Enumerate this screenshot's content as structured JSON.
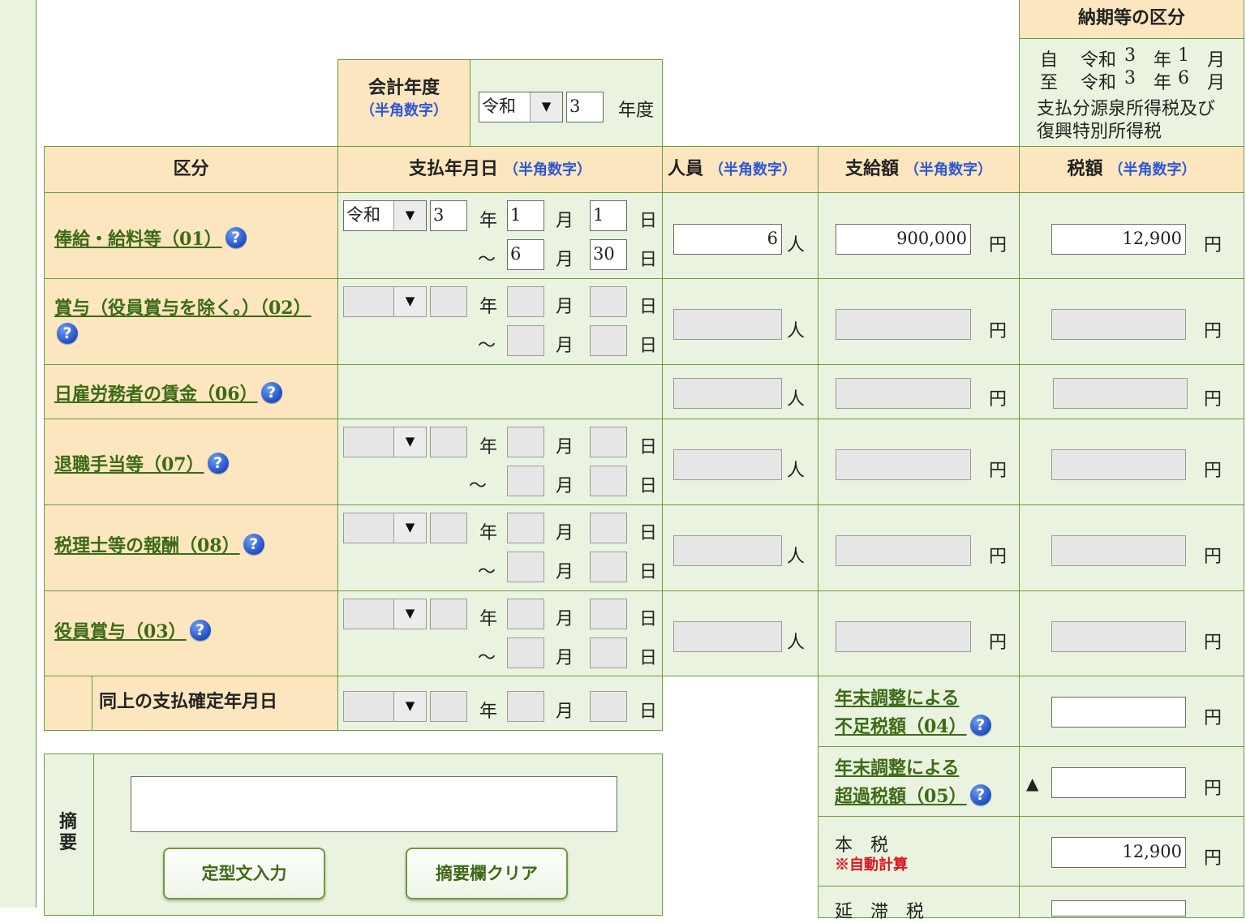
{
  "period": {
    "header": "納期等の区分",
    "from": {
      "prefix": "自",
      "era": "令和",
      "year": "3",
      "year_unit": "年",
      "month": "1",
      "month_unit": "月"
    },
    "to": {
      "prefix": "至",
      "era": "令和",
      "year": "3",
      "year_unit": "年",
      "month": "6",
      "month_unit": "月"
    },
    "desc_line1": "支払分源泉所得税及び",
    "desc_line2": "復興特別所得税"
  },
  "fiscal": {
    "label": "会計年度",
    "hint": "（半角数字）",
    "era": "令和",
    "year": "3",
    "unit": "年度"
  },
  "headers": {
    "kubun": "区分",
    "date": "支払年月日",
    "date_hint": "（半角数字）",
    "people": "人員",
    "people_hint": "（半角数字）",
    "amount": "支給額",
    "amount_hint": "（半角数字）",
    "tax": "税額",
    "tax_hint": "（半角数字）"
  },
  "units": {
    "year": "年",
    "month": "月",
    "day": "日",
    "tilde": "～",
    "person": "人",
    "yen": "円"
  },
  "rows": {
    "salary": {
      "label": "俸給・給料等（01）",
      "era": "令和",
      "year": "3",
      "month": "1",
      "day": "1",
      "end_month": "6",
      "end_day": "30",
      "people": "6",
      "amount": "900,000",
      "tax": "12,900"
    },
    "bonus": {
      "label": "賞与（役員賞与を除く。）（02）"
    },
    "daily": {
      "label": "日雇労務者の賃金（06）"
    },
    "retire": {
      "label": "退職手当等（07）"
    },
    "accountant": {
      "label": "税理士等の報酬（08）"
    },
    "officer": {
      "label": "役員賞与（03）",
      "confirm_label": "同上の支払確定年月日"
    }
  },
  "adjust": {
    "short": {
      "line1": "年末調整による",
      "line2": "不足税額（04）"
    },
    "excess": {
      "line1": "年末調整による",
      "line2": "超過税額（05）",
      "mark": "▲"
    },
    "main_tax": {
      "label": "本　税",
      "note": "※自動計算",
      "value": "12,900"
    },
    "delay_label": "延　滞　税"
  },
  "summary": {
    "label": "摘要",
    "fixed_text_button": "定型文入力",
    "clear_button": "摘要欄クリア"
  },
  "help_icon_glyph": "?",
  "colors": {
    "header_bg": "#fbe6bf",
    "cell_bg": "#eaf3df",
    "border": "#6e9a3c",
    "link": "#3c6a16",
    "hint": "#2e56d6",
    "note": "#e0101b"
  }
}
